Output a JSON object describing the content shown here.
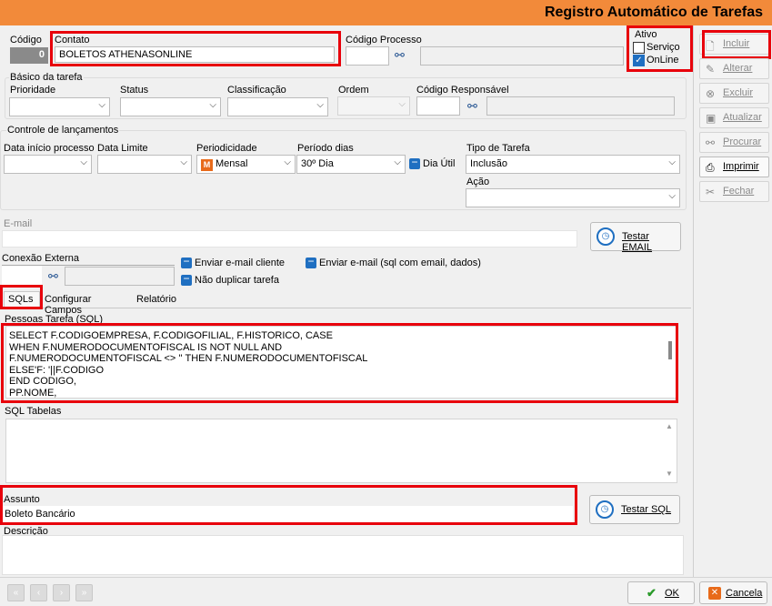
{
  "window": {
    "title": "Registro Automático de Tarefas"
  },
  "header": {
    "codigo_label": "Código",
    "codigo_value": "0",
    "contato_label": "Contato",
    "contato_value": "BOLETOS ATHENASONLINE",
    "codigo_processo_label": "Código Processo",
    "codigo_processo_value": "",
    "ativo_label": "Ativo",
    "servico_label": "Serviço",
    "online_label": "OnLine",
    "servico_checked": false,
    "online_checked": true
  },
  "basico": {
    "group_label": "Básico da tarefa",
    "prioridade_label": "Prioridade",
    "status_label": "Status",
    "classificacao_label": "Classificação",
    "ordem_label": "Ordem",
    "codigo_responsavel_label": "Código Responsável"
  },
  "controle": {
    "group_label": "Controle de lançamentos",
    "data_inicio_label": "Data início processo",
    "data_limite_label": "Data Limite",
    "periodicidade_label": "Periodicidade",
    "periodicidade_value": "Mensal",
    "periodicidade_icon": "M",
    "periodo_dias_label": "Período dias",
    "periodo_dias_value": "30º Dia",
    "dia_util_label": "Dia Útil",
    "tipo_tarefa_label": "Tipo de Tarefa",
    "tipo_tarefa_value": "Inclusão",
    "acao_label": "Ação",
    "acao_value": ""
  },
  "email": {
    "label": "E-mail",
    "value": "",
    "testar_label": "Testar EMAIL"
  },
  "conexao": {
    "label": "Conexão Externa",
    "enviar_cliente_label": "Enviar e-mail cliente",
    "nao_duplicar_label": "Não duplicar tarefa",
    "enviar_sql_label": "Enviar e-mail (sql com email, dados)"
  },
  "tabs": [
    {
      "label": "SQLs",
      "active": true
    },
    {
      "label": "Configurar Campos",
      "active": false
    },
    {
      "label": "Relatório",
      "active": false
    }
  ],
  "sql": {
    "pessoas_label": "Pessoas Tarefa (SQL)",
    "pessoas_lines": [
      "SELECT  F.CODIGOEMPRESA, F.CODIGOFILIAL, F.HISTORICO, CASE",
      "WHEN F.NUMERODOCUMENTOFISCAL IS NOT NULL AND",
      "F.NUMERODOCUMENTOFISCAL <> '' THEN F.NUMERODOCUMENTOFISCAL",
      "ELSE'F: '||F.CODIGO",
      "END CODIGO,",
      "PP.NOME,"
    ],
    "tabelas_label": "SQL Tabelas",
    "tabelas_value": ""
  },
  "assunto": {
    "label": "Assunto",
    "value": "Boleto Bancário",
    "testar_sql_label": "Testar SQL"
  },
  "descricao": {
    "label": "Descrição",
    "value": ""
  },
  "sidebar": {
    "incluir": "Incluir",
    "alterar": "Alterar",
    "excluir": "Excluir",
    "atualizar": "Atualizar",
    "procurar": "Procurar",
    "imprimir": "Imprimir",
    "fechar": "Fechar"
  },
  "footer": {
    "ok_label": "OK",
    "cancela_label": "Cancela"
  },
  "colors": {
    "title_bar": "#f28a3a",
    "highlight": "#e8000b",
    "accent_blue": "#1f6fc1"
  }
}
